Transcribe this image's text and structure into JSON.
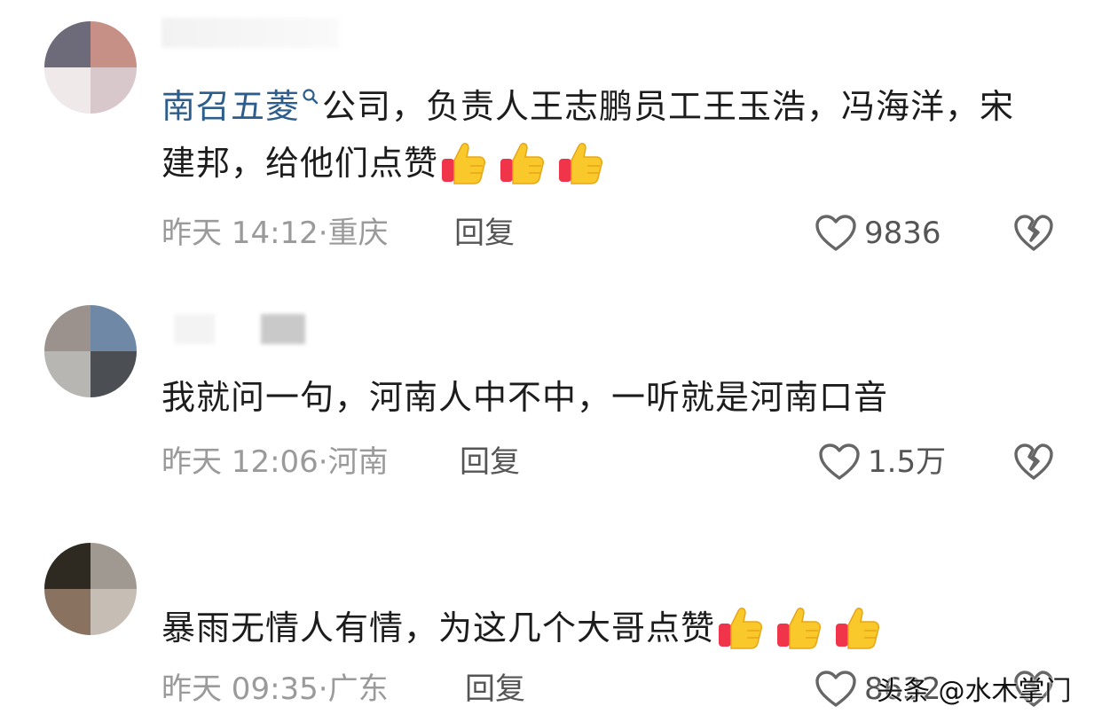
{
  "comments": [
    {
      "mention": "南召五菱",
      "text": "公司，负责人王志鹏员工王玉浩，冯海洋，宋建邦，给他们点赞",
      "thumb_count": 3,
      "time": "昨天 14:12",
      "separator": "·",
      "location": "重庆",
      "reply_label": "回复",
      "likes": "9836"
    },
    {
      "text": "我就问一句，河南人中不中，一听就是河南口音",
      "time": "昨天 12:06",
      "separator": "·",
      "location": "河南",
      "reply_label": "回复",
      "likes": "1.5万"
    },
    {
      "text": "暴雨无情人有情，为这几个大哥点赞",
      "thumb_count": 3,
      "time": "昨天 09:35",
      "separator": "·",
      "location": "广东",
      "reply_label": "回复",
      "likes": "8632"
    }
  ],
  "watermark": "头条 @水木掌门",
  "colors": {
    "mention": "#2d5d8a",
    "meta": "#9a9a9a",
    "thumb": "#f7c52a"
  },
  "icons": [
    "search-icon",
    "thumbs-up-emoji",
    "heart-outline-icon",
    "broken-heart-icon"
  ]
}
